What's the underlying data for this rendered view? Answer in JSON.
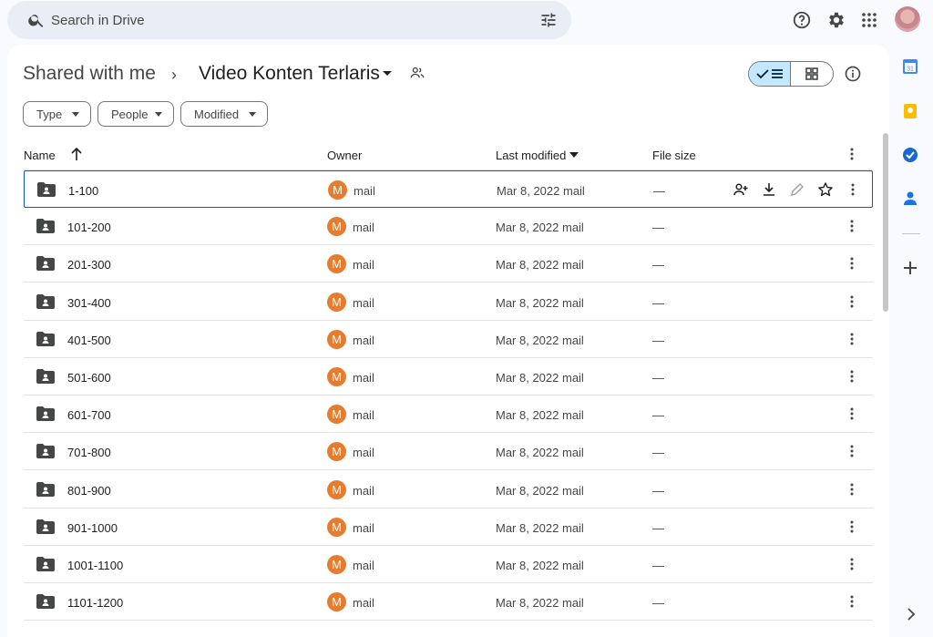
{
  "search": {
    "placeholder": "Search in Drive"
  },
  "breadcrumb": {
    "parent": "Shared with me",
    "separator": "›",
    "current": "Video Konten Terlaris"
  },
  "filters": [
    {
      "label": "Type"
    },
    {
      "label": "People"
    },
    {
      "label": "Modified"
    }
  ],
  "table": {
    "headers": {
      "name": "Name",
      "owner": "Owner",
      "modified": "Last modified",
      "size": "File size"
    },
    "rows": [
      {
        "name": "1-100",
        "owner_initial": "M",
        "owner": "mail",
        "modified": "Mar 8, 2022 mail",
        "size": "—"
      },
      {
        "name": "101-200",
        "owner_initial": "M",
        "owner": "mail",
        "modified": "Mar 8, 2022 mail",
        "size": "—"
      },
      {
        "name": "201-300",
        "owner_initial": "M",
        "owner": "mail",
        "modified": "Mar 8, 2022 mail",
        "size": "—"
      },
      {
        "name": "301-400",
        "owner_initial": "M",
        "owner": "mail",
        "modified": "Mar 8, 2022 mail",
        "size": "—"
      },
      {
        "name": "401-500",
        "owner_initial": "M",
        "owner": "mail",
        "modified": "Mar 8, 2022 mail",
        "size": "—"
      },
      {
        "name": "501-600",
        "owner_initial": "M",
        "owner": "mail",
        "modified": "Mar 8, 2022 mail",
        "size": "—"
      },
      {
        "name": "601-700",
        "owner_initial": "M",
        "owner": "mail",
        "modified": "Mar 8, 2022 mail",
        "size": "—"
      },
      {
        "name": "701-800",
        "owner_initial": "M",
        "owner": "mail",
        "modified": "Mar 8, 2022 mail",
        "size": "—"
      },
      {
        "name": "801-900",
        "owner_initial": "M",
        "owner": "mail",
        "modified": "Mar 8, 2022 mail",
        "size": "—"
      },
      {
        "name": "901-1000",
        "owner_initial": "M",
        "owner": "mail",
        "modified": "Mar 8, 2022 mail",
        "size": "—"
      },
      {
        "name": "1001-1100",
        "owner_initial": "M",
        "owner": "mail",
        "modified": "Mar 8, 2022 mail",
        "size": "—"
      },
      {
        "name": "1101-1200",
        "owner_initial": "M",
        "owner": "mail",
        "modified": "Mar 8, 2022 mail",
        "size": "—"
      }
    ]
  },
  "side_panel": {
    "calendar_day": "31"
  },
  "colors": {
    "accent": "#0b57d0",
    "selected_view": "#c2e7ff",
    "owner_avatar": "#e67c2e"
  }
}
